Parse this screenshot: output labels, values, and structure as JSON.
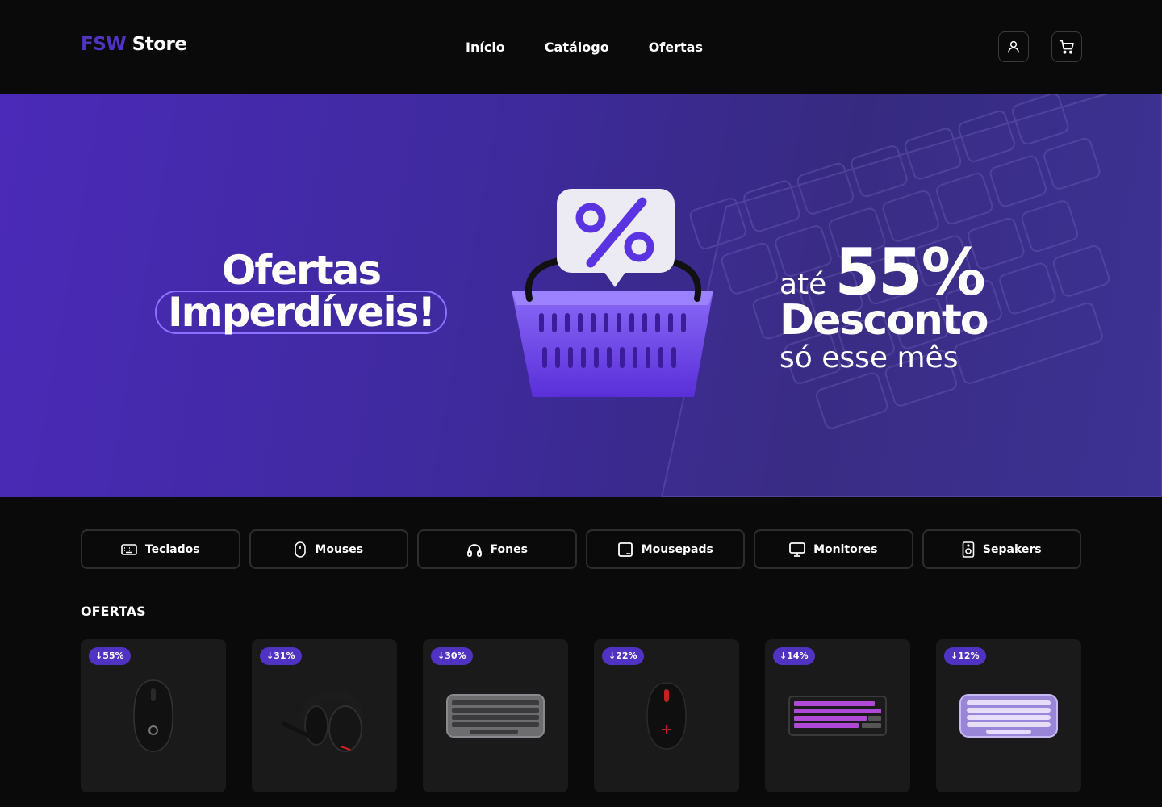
{
  "header": {
    "logo_accent": "FSW",
    "logo_rest": "Store",
    "nav": [
      "Início",
      "Catálogo",
      "Ofertas"
    ],
    "icons": [
      "user-icon",
      "cart-icon"
    ]
  },
  "banner": {
    "line1": "Ofertas",
    "line2": "Imperdíveis!",
    "ate": "até",
    "percent": "55%",
    "desconto": "Desconto",
    "so": "só esse mês"
  },
  "categories": [
    {
      "label": "Teclados",
      "icon": "keyboard-icon"
    },
    {
      "label": "Mouses",
      "icon": "mouse-icon"
    },
    {
      "label": "Fones",
      "icon": "headphones-icon"
    },
    {
      "label": "Mousepads",
      "icon": "mousepad-icon"
    },
    {
      "label": "Monitores",
      "icon": "monitor-icon"
    },
    {
      "label": "Sepakers",
      "icon": "speaker-icon"
    }
  ],
  "offers": {
    "title": "OFERTAS",
    "products": [
      {
        "discount": "55%",
        "image": "mouse"
      },
      {
        "discount": "31%",
        "image": "headset"
      },
      {
        "discount": "30%",
        "image": "keyboard"
      },
      {
        "discount": "22%",
        "image": "mouse"
      },
      {
        "discount": "14%",
        "image": "keyboard"
      },
      {
        "discount": "12%",
        "image": "keyboard"
      }
    ]
  },
  "colors": {
    "accent": "#5033c3",
    "background": "#0a0a0a",
    "card": "#1a1a1a"
  }
}
